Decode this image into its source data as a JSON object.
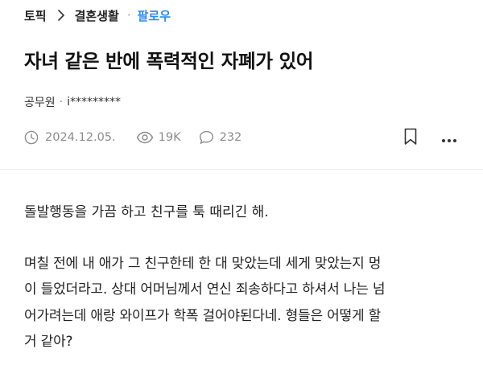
{
  "breadcrumb": {
    "topic": "토픽",
    "category": "결혼생활",
    "dot": "·",
    "follow": "팔로우"
  },
  "post": {
    "title": "자녀 같은 반에 폭력적인 자폐가 있어",
    "author": {
      "job": "공무원",
      "sep": "·",
      "nickname": "i*********"
    },
    "date": "2024.12.05.",
    "views": "19K",
    "comments": "232",
    "body": {
      "paragraph1": "돌발행동을 가끔 하고 친구를 툭 때리긴 해.",
      "paragraph2_lines": [
        "며칠 전에 내 애가 그 친구한테 한 대 맞았는데 세게 맞았는지 멍",
        "이 들었더라고. 상대 어머님께서 연신 죄송하다고 하셔서 나는 넘",
        "어가려는데 애랑 와이프가 학폭 걸어야된다네. 형들은 어떻게 할",
        "거 같아?"
      ]
    }
  },
  "colors": {
    "accent": "#2d8cf0",
    "meta_gray": "#8c8c8c",
    "divider": "#ececec"
  },
  "icons": {
    "breadcrumb_separator": "chevron-right-icon",
    "date": "clock-icon",
    "views": "eye-icon",
    "comments": "comment-bubble-icon",
    "bookmark": "bookmark-icon",
    "more": "more-vertical-icon"
  }
}
